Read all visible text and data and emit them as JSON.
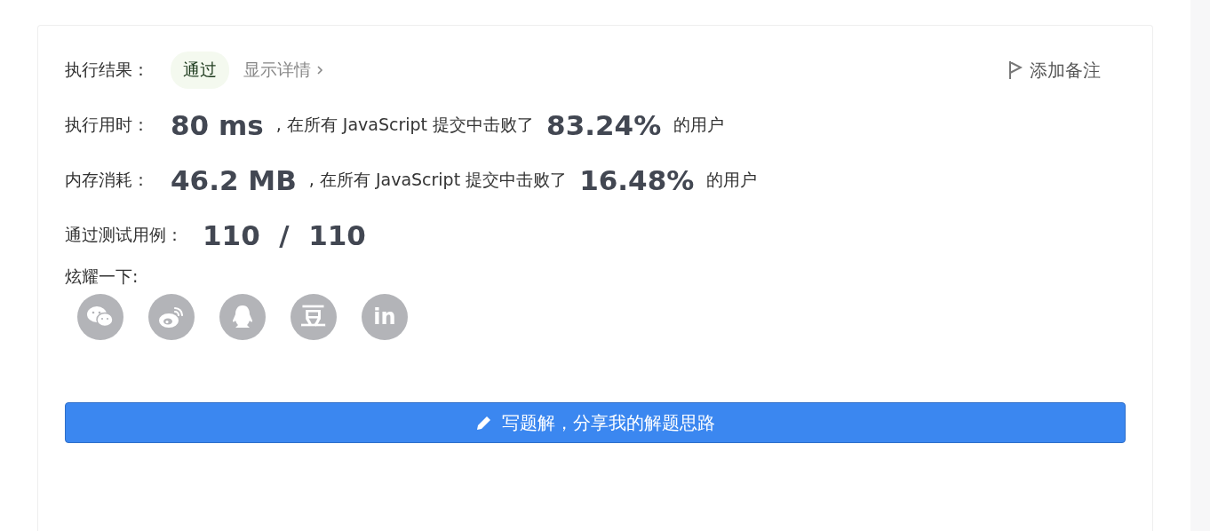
{
  "result": {
    "label": "执行结果：",
    "status": "通过",
    "details_link": "显示详情",
    "add_note": "添加备注"
  },
  "stats": [
    {
      "label": "执行用时：",
      "value": "80 ms",
      "text": ", 在所有 JavaScript 提交中击败了",
      "percent": "83.24%",
      "suffix": "的用户"
    },
    {
      "label": "内存消耗：",
      "value": "46.2 MB",
      "text": ", 在所有 JavaScript 提交中击败了",
      "percent": "16.48%",
      "suffix": "的用户"
    }
  ],
  "tests": {
    "label": "通过测试用例：",
    "value": "110  /  110"
  },
  "share": {
    "label": "炫耀一下:",
    "items": [
      {
        "kind": "wechat"
      },
      {
        "kind": "weibo"
      },
      {
        "kind": "qq"
      },
      {
        "kind": "douban",
        "glyph": "豆"
      },
      {
        "kind": "linkedin",
        "glyph": "in"
      }
    ]
  },
  "write_button": "写题解，分享我的解题思路"
}
